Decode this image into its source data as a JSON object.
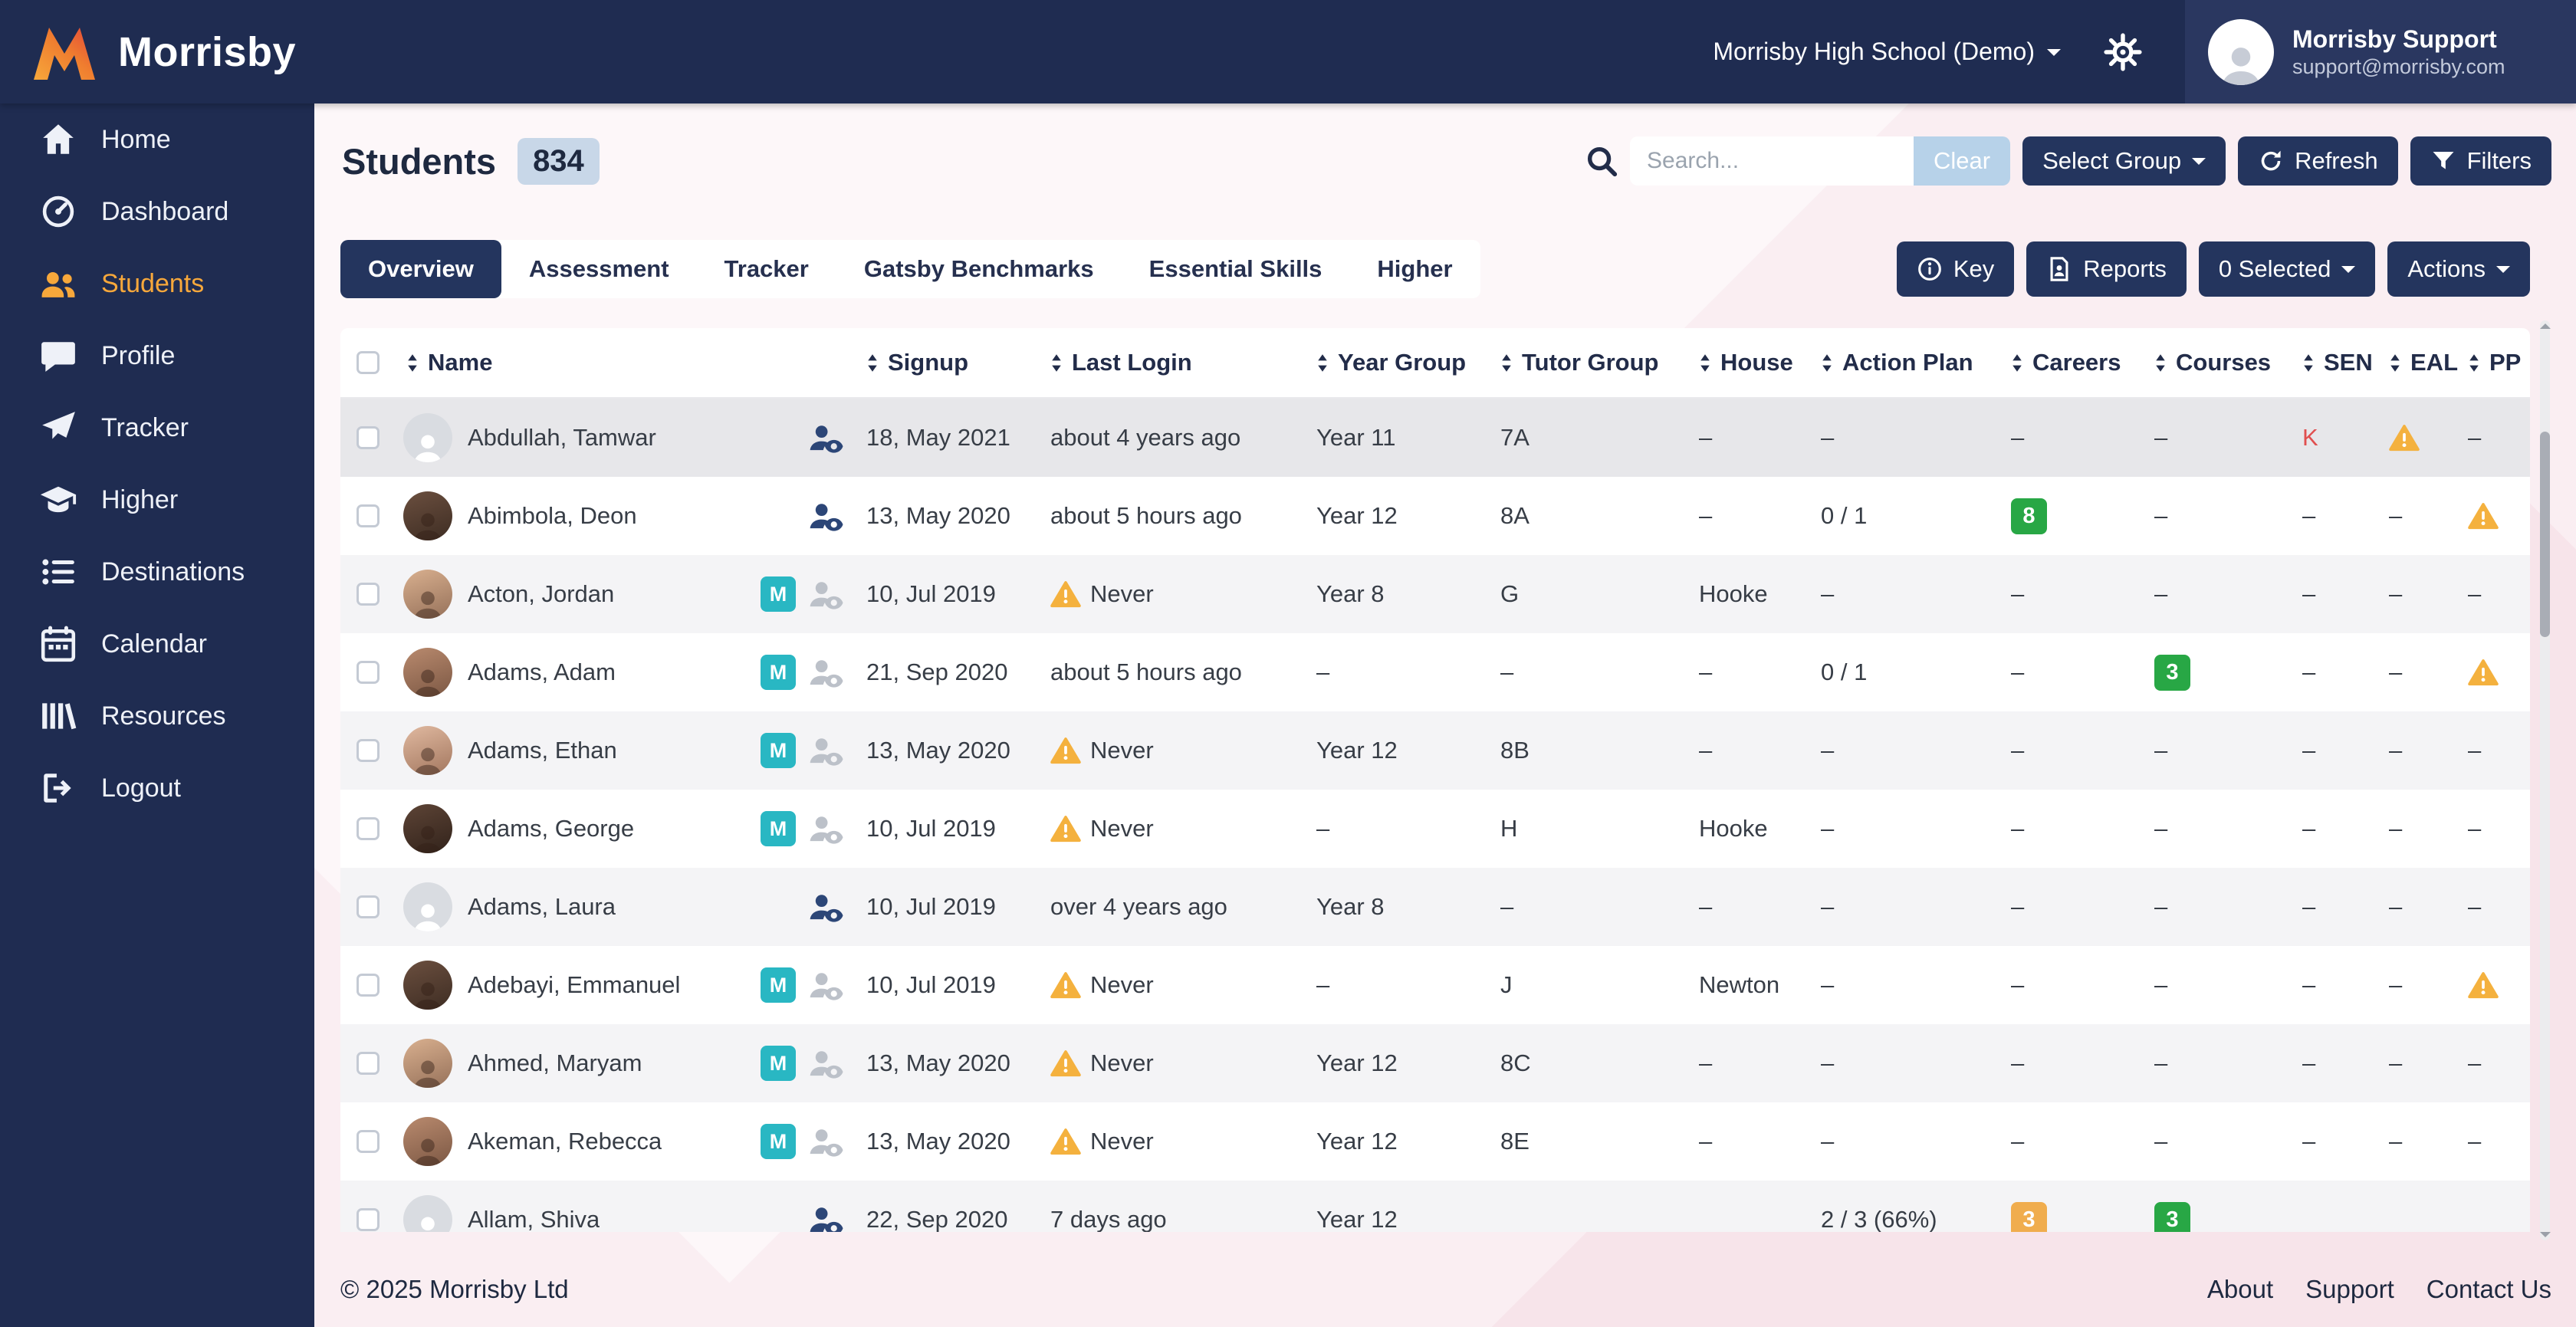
{
  "brand": {
    "name": "Morrisby",
    "logo_icon": "morrisby-logo"
  },
  "topbar": {
    "school_selector_label": "Morrisby High School (Demo)",
    "settings_icon": "gear-icon",
    "user_name": "Morrisby Support",
    "user_email": "support@morrisby.com"
  },
  "sidebar": {
    "items": [
      {
        "label": "Home",
        "icon": "home-icon",
        "active": false
      },
      {
        "label": "Dashboard",
        "icon": "dashboard-icon",
        "active": false
      },
      {
        "label": "Students",
        "icon": "students-icon",
        "active": true
      },
      {
        "label": "Profile",
        "icon": "profile-icon",
        "active": false
      },
      {
        "label": "Tracker",
        "icon": "tracker-icon",
        "active": false
      },
      {
        "label": "Higher",
        "icon": "higher-icon",
        "active": false
      },
      {
        "label": "Destinations",
        "icon": "destinations-icon",
        "active": false
      },
      {
        "label": "Calendar",
        "icon": "calendar-icon",
        "active": false
      },
      {
        "label": "Resources",
        "icon": "resources-icon",
        "active": false
      },
      {
        "label": "Logout",
        "icon": "logout-icon",
        "active": false
      }
    ]
  },
  "header": {
    "title": "Students",
    "count": "834",
    "search": {
      "placeholder": "Search...",
      "icon": "search-icon"
    },
    "buttons": {
      "clear": "Clear",
      "select_group": "Select Group",
      "refresh": "Refresh",
      "filters": "Filters"
    }
  },
  "tabs": [
    {
      "label": "Overview",
      "active": true
    },
    {
      "label": "Assessment",
      "active": false
    },
    {
      "label": "Tracker",
      "active": false
    },
    {
      "label": "Gatsby Benchmarks",
      "active": false
    },
    {
      "label": "Essential Skills",
      "active": false
    },
    {
      "label": "Higher",
      "active": false
    }
  ],
  "toolbar": {
    "key": "Key",
    "key_icon": "info-icon",
    "reports": "Reports",
    "reports_icon": "report-icon",
    "selected": "0 Selected",
    "actions": "Actions"
  },
  "table": {
    "m_badge_label": "M",
    "columns": [
      {
        "label": "Name"
      },
      {
        "label": "Signup"
      },
      {
        "label": "Last Login"
      },
      {
        "label": "Year Group"
      },
      {
        "label": "Tutor Group"
      },
      {
        "label": "House"
      },
      {
        "label": "Action Plan"
      },
      {
        "label": "Careers"
      },
      {
        "label": "Courses"
      },
      {
        "label": "SEN"
      },
      {
        "label": "EAL"
      },
      {
        "label": "PP"
      }
    ],
    "rows": [
      {
        "name": "Abdullah, Tamwar",
        "avatar": "placeholder",
        "m_badge": false,
        "account": "active",
        "signup": "18, May 2021",
        "last_login": "about 4 years ago",
        "login_warn": false,
        "year_group": "Year 11",
        "tutor_group": "7A",
        "house": "–",
        "action_plan": "–",
        "careers": {
          "text": "–"
        },
        "courses": {
          "text": "–"
        },
        "sen": {
          "text": "K",
          "red": true
        },
        "eal": {
          "warn": true
        },
        "pp": {
          "text": "–"
        },
        "highlight": true
      },
      {
        "name": "Abimbola, Deon",
        "avatar": "photo",
        "m_badge": false,
        "account": "active",
        "signup": "13, May 2020",
        "last_login": "about 5 hours ago",
        "login_warn": false,
        "year_group": "Year 12",
        "tutor_group": "8A",
        "house": "–",
        "action_plan": "0 / 1",
        "careers": {
          "badge": "8",
          "color": "green"
        },
        "courses": {
          "text": "–"
        },
        "sen": {
          "text": "–"
        },
        "eal": {
          "text": "–"
        },
        "pp": {
          "warn": true
        }
      },
      {
        "name": "Acton, Jordan",
        "avatar": "photo",
        "m_badge": true,
        "account": "inactive",
        "signup": "10, Jul 2019",
        "last_login": "Never",
        "login_warn": true,
        "year_group": "Year 8",
        "tutor_group": "G",
        "house": "Hooke",
        "action_plan": "–",
        "careers": {
          "text": "–"
        },
        "courses": {
          "text": "–"
        },
        "sen": {
          "text": "–"
        },
        "eal": {
          "text": "–"
        },
        "pp": {
          "text": "–"
        }
      },
      {
        "name": "Adams, Adam",
        "avatar": "photo",
        "m_badge": true,
        "account": "inactive",
        "signup": "21, Sep 2020",
        "last_login": "about 5 hours ago",
        "login_warn": false,
        "year_group": "–",
        "tutor_group": "–",
        "house": "–",
        "action_plan": "0 / 1",
        "careers": {
          "text": "–"
        },
        "courses": {
          "badge": "3",
          "color": "green"
        },
        "sen": {
          "text": "–"
        },
        "eal": {
          "text": "–"
        },
        "pp": {
          "warn": true
        }
      },
      {
        "name": "Adams, Ethan",
        "avatar": "photo",
        "m_badge": true,
        "account": "inactive",
        "signup": "13, May 2020",
        "last_login": "Never",
        "login_warn": true,
        "year_group": "Year 12",
        "tutor_group": "8B",
        "house": "–",
        "action_plan": "–",
        "careers": {
          "text": "–"
        },
        "courses": {
          "text": "–"
        },
        "sen": {
          "text": "–"
        },
        "eal": {
          "text": "–"
        },
        "pp": {
          "text": "–"
        }
      },
      {
        "name": "Adams, George",
        "avatar": "photo",
        "m_badge": true,
        "account": "inactive",
        "signup": "10, Jul 2019",
        "last_login": "Never",
        "login_warn": true,
        "year_group": "–",
        "tutor_group": "H",
        "house": "Hooke",
        "action_plan": "–",
        "careers": {
          "text": "–"
        },
        "courses": {
          "text": "–"
        },
        "sen": {
          "text": "–"
        },
        "eal": {
          "text": "–"
        },
        "pp": {
          "text": "–"
        }
      },
      {
        "name": "Adams, Laura",
        "avatar": "placeholder",
        "m_badge": false,
        "account": "active",
        "signup": "10, Jul 2019",
        "last_login": "over 4 years ago",
        "login_warn": false,
        "year_group": "Year 8",
        "tutor_group": "–",
        "house": "–",
        "action_plan": "–",
        "careers": {
          "text": "–"
        },
        "courses": {
          "text": "–"
        },
        "sen": {
          "text": "–"
        },
        "eal": {
          "text": "–"
        },
        "pp": {
          "text": "–"
        }
      },
      {
        "name": "Adebayi, Emmanuel",
        "avatar": "photo",
        "m_badge": true,
        "account": "inactive",
        "signup": "10, Jul 2019",
        "last_login": "Never",
        "login_warn": true,
        "year_group": "–",
        "tutor_group": "J",
        "house": "Newton",
        "action_plan": "–",
        "careers": {
          "text": "–"
        },
        "courses": {
          "text": "–"
        },
        "sen": {
          "text": "–"
        },
        "eal": {
          "text": "–"
        },
        "pp": {
          "warn": true
        }
      },
      {
        "name": "Ahmed, Maryam",
        "avatar": "photo",
        "m_badge": true,
        "account": "inactive",
        "signup": "13, May 2020",
        "last_login": "Never",
        "login_warn": true,
        "year_group": "Year 12",
        "tutor_group": "8C",
        "house": "–",
        "action_plan": "–",
        "careers": {
          "text": "–"
        },
        "courses": {
          "text": "–"
        },
        "sen": {
          "text": "–"
        },
        "eal": {
          "text": "–"
        },
        "pp": {
          "text": "–"
        }
      },
      {
        "name": "Akeman, Rebecca",
        "avatar": "photo",
        "m_badge": true,
        "account": "inactive",
        "signup": "13, May 2020",
        "last_login": "Never",
        "login_warn": true,
        "year_group": "Year 12",
        "tutor_group": "8E",
        "house": "–",
        "action_plan": "–",
        "careers": {
          "text": "–"
        },
        "courses": {
          "text": "–"
        },
        "sen": {
          "text": "–"
        },
        "eal": {
          "text": "–"
        },
        "pp": {
          "text": "–"
        }
      },
      {
        "name": "Allam, Shiva",
        "avatar": "placeholder",
        "m_badge": false,
        "account": "active",
        "signup": "22, Sep 2020",
        "last_login": "7 days ago",
        "login_warn": false,
        "year_group": "Year 12",
        "tutor_group": "",
        "house": "",
        "action_plan": "2 / 3 (66%)",
        "careers": {
          "badge": "3",
          "color": "yellow"
        },
        "courses": {
          "badge": "3",
          "color": "green"
        },
        "sen": {
          "text": ""
        },
        "eal": {
          "text": ""
        },
        "pp": {
          "text": ""
        },
        "partial": true
      }
    ]
  },
  "footer": {
    "copyright": "© 2025 Morrisby Ltd",
    "links": [
      {
        "label": "About"
      },
      {
        "label": "Support"
      },
      {
        "label": "Contact Us"
      }
    ]
  },
  "colors": {
    "navy": "#1f2c51",
    "button_navy": "#24355e",
    "accent_orange": "#f7a83b",
    "clear_button_blue": "#b7d2e9",
    "count_badge_blue": "#c8d7e8",
    "badge_green": "#28a745",
    "badge_yellow": "#f0ad4e",
    "warning_yellow": "#f4b13e",
    "managed_teal": "#29b7c3",
    "sen_red": "#e04f4f",
    "background_pink": "#faeef2"
  }
}
